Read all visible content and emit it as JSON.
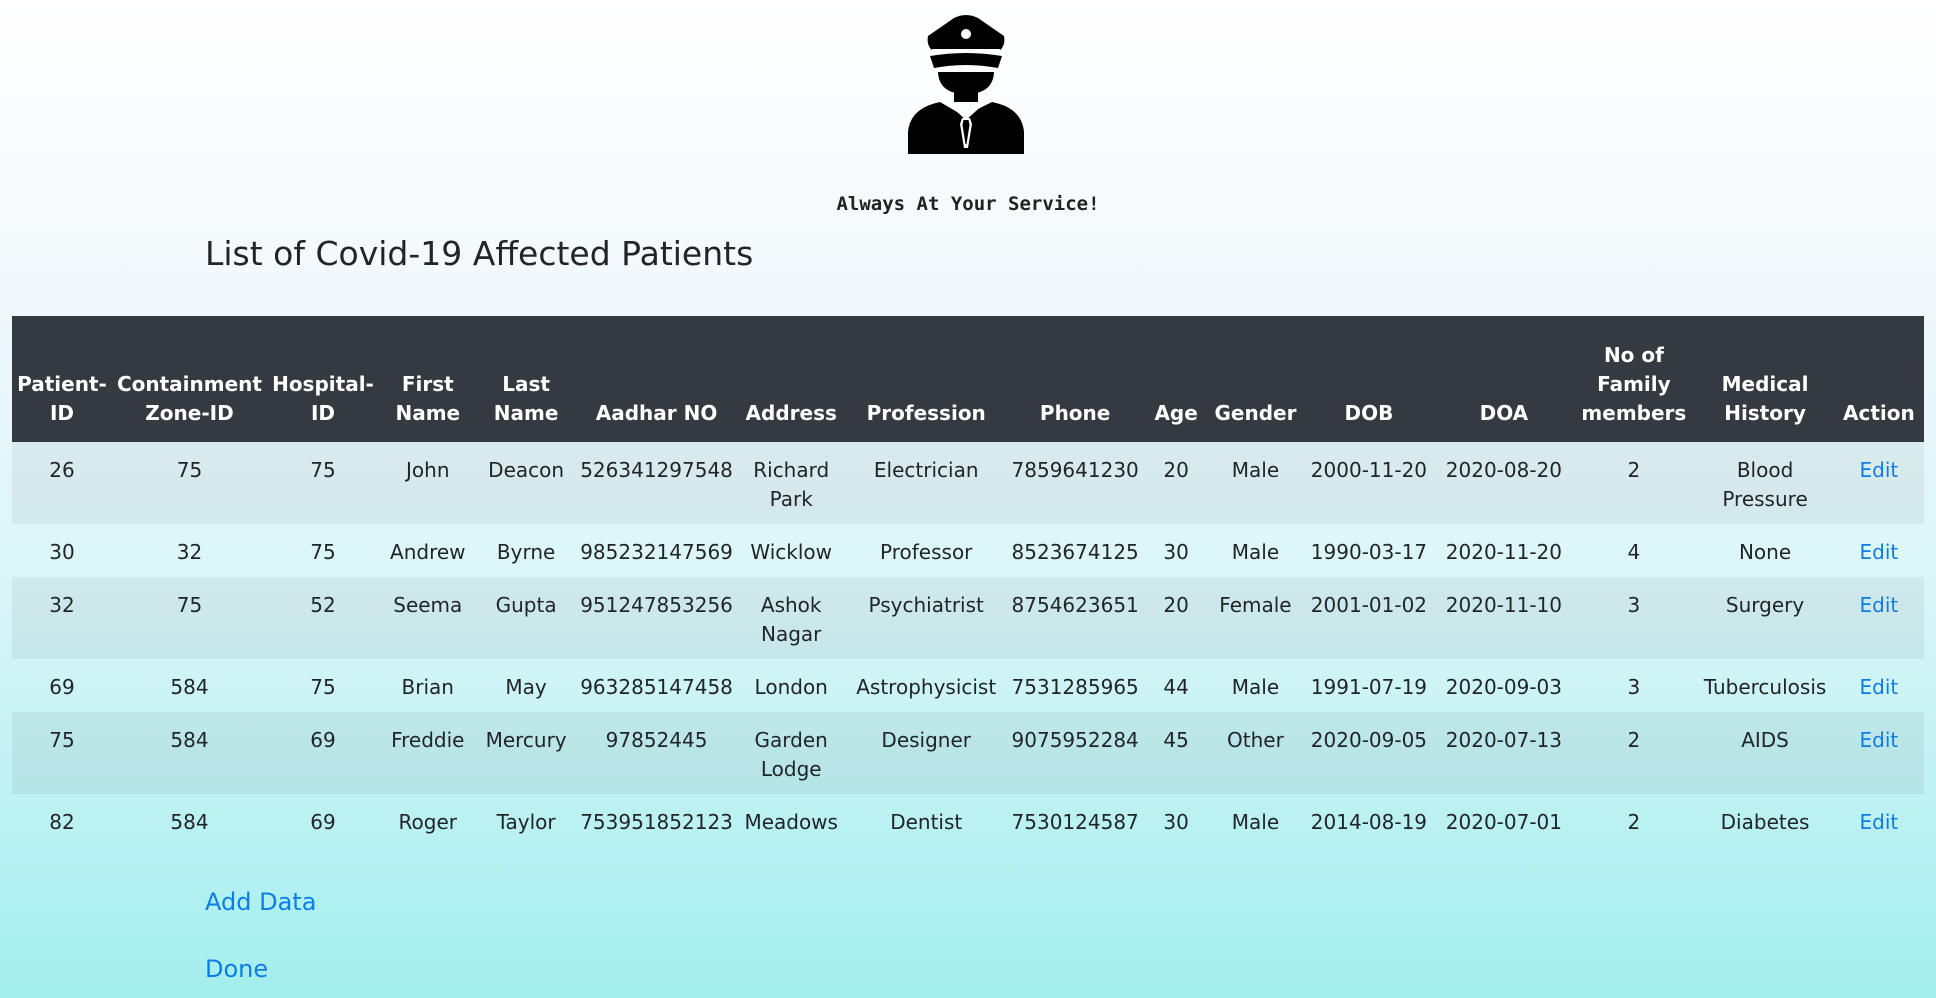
{
  "logo": {
    "icon": "officer-icon",
    "alt": "police officer"
  },
  "tagline": "Always At Your Service!",
  "page_title": "List of Covid-19 Affected Patients",
  "table": {
    "headers": [
      "Patient-ID",
      "Containment Zone-ID",
      "Hospital-ID",
      "First Name",
      "Last Name",
      "Aadhar NO",
      "Address",
      "Profession",
      "Phone",
      "Age",
      "Gender",
      "DOB",
      "DOA",
      "No of Family members",
      "Medical History",
      "Action"
    ],
    "rows": [
      [
        "26",
        "75",
        "75",
        "John",
        "Deacon",
        "526341297548",
        "Richard Park",
        "Electrician",
        "7859641230",
        "20",
        "Male",
        "2000-11-20",
        "2020-08-20",
        "2",
        "Blood Pressure",
        "Edit"
      ],
      [
        "30",
        "32",
        "75",
        "Andrew",
        "Byrne",
        "985232147569",
        "Wicklow",
        "Professor",
        "8523674125",
        "30",
        "Male",
        "1990-03-17",
        "2020-11-20",
        "4",
        "None",
        "Edit"
      ],
      [
        "32",
        "75",
        "52",
        "Seema",
        "Gupta",
        "951247853256",
        "Ashok Nagar",
        "Psychiatrist",
        "8754623651",
        "20",
        "Female",
        "2001-01-02",
        "2020-11-10",
        "3",
        "Surgery",
        "Edit"
      ],
      [
        "69",
        "584",
        "75",
        "Brian",
        "May",
        "963285147458",
        "London",
        "Astrophysicist",
        "7531285965",
        "44",
        "Male",
        "1991-07-19",
        "2020-09-03",
        "3",
        "Tuberculosis",
        "Edit"
      ],
      [
        "75",
        "584",
        "69",
        "Freddie",
        "Mercury",
        "97852445",
        "Garden Lodge",
        "Designer",
        "9075952284",
        "45",
        "Other",
        "2020-09-05",
        "2020-07-13",
        "2",
        "AIDS",
        "Edit"
      ],
      [
        "82",
        "584",
        "69",
        "Roger",
        "Taylor",
        "753951852123",
        "Meadows",
        "Dentist",
        "7530124587",
        "30",
        "Male",
        "2014-08-19",
        "2020-07-01",
        "2",
        "Diabetes",
        "Edit"
      ]
    ]
  },
  "links": {
    "add_data": "Add Data",
    "done": "Done"
  },
  "colors": {
    "header_bg": "#343a40",
    "link": "#0d7de6",
    "accent": "#a3eeee"
  }
}
